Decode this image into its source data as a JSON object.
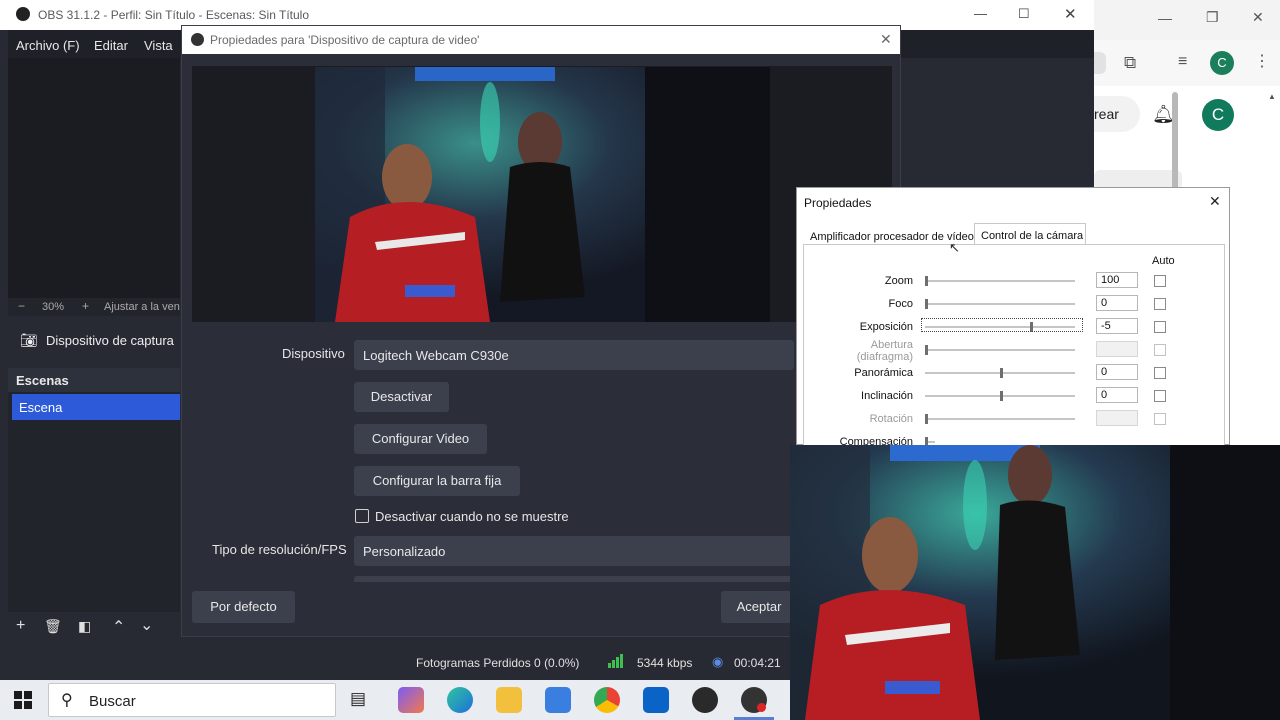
{
  "browser": {
    "button_partial": "rear",
    "profile_initial": "C",
    "avatar_initial": "C",
    "colors": {
      "profile": "#1a7f5a"
    }
  },
  "obs": {
    "title": "OBS 31.1.2 - Perfil: Sin Título - Escenas: Sin Título",
    "menu": [
      "Archivo (F)",
      "Editar",
      "Vista"
    ],
    "zoom_percent": "30%",
    "zoom_fit_label": "Ajustar a la ven",
    "source_name": "Dispositivo de captura",
    "scenes_header": "Escenas",
    "scenes": [
      "Escena"
    ],
    "status": {
      "frames_dropped": "Fotogramas Perdidos 0 (0.0%)",
      "bitrate": "5344 kbps",
      "time": "00:04:21"
    }
  },
  "dialog": {
    "title": "Propiedades para 'Dispositivo de captura de video'",
    "device_label": "Dispositivo",
    "device_value": "Logitech Webcam C930e",
    "deactivate_button": "Desactivar",
    "config_video_button": "Configurar Video",
    "config_bar_button": "Configurar la barra fija",
    "hide_checkbox_label": "Desactivar cuando no se muestre",
    "resolution_label": "Tipo de resolución/FPS",
    "resolution_value": "Personalizado",
    "defaults_button": "Por defecto",
    "accept_button": "Aceptar"
  },
  "win_props": {
    "title": "Propiedades",
    "tabs": [
      "Amplificador procesador de vídeo",
      "Control de la cámara"
    ],
    "auto_header": "Auto",
    "rows": [
      {
        "label": "Zoom",
        "value": "100",
        "level": 0.0,
        "enabled": true
      },
      {
        "label": "Foco",
        "value": "0",
        "level": 0.0,
        "enabled": true
      },
      {
        "label": "Exposición",
        "value": "-5",
        "level": 0.7,
        "enabled": true
      },
      {
        "label": "Abertura\n(diafragma)",
        "value": "",
        "level": 0.0,
        "enabled": false
      },
      {
        "label": "Panorámica",
        "value": "0",
        "level": 0.5,
        "enabled": true
      },
      {
        "label": "Inclinación",
        "value": "0",
        "level": 0.5,
        "enabled": true
      },
      {
        "label": "Rotación",
        "value": "",
        "level": 0.0,
        "enabled": false
      },
      {
        "label": "Compensación",
        "value": "",
        "level": 0.0,
        "enabled": true
      }
    ]
  },
  "taskbar": {
    "search_placeholder": "Buscar"
  }
}
